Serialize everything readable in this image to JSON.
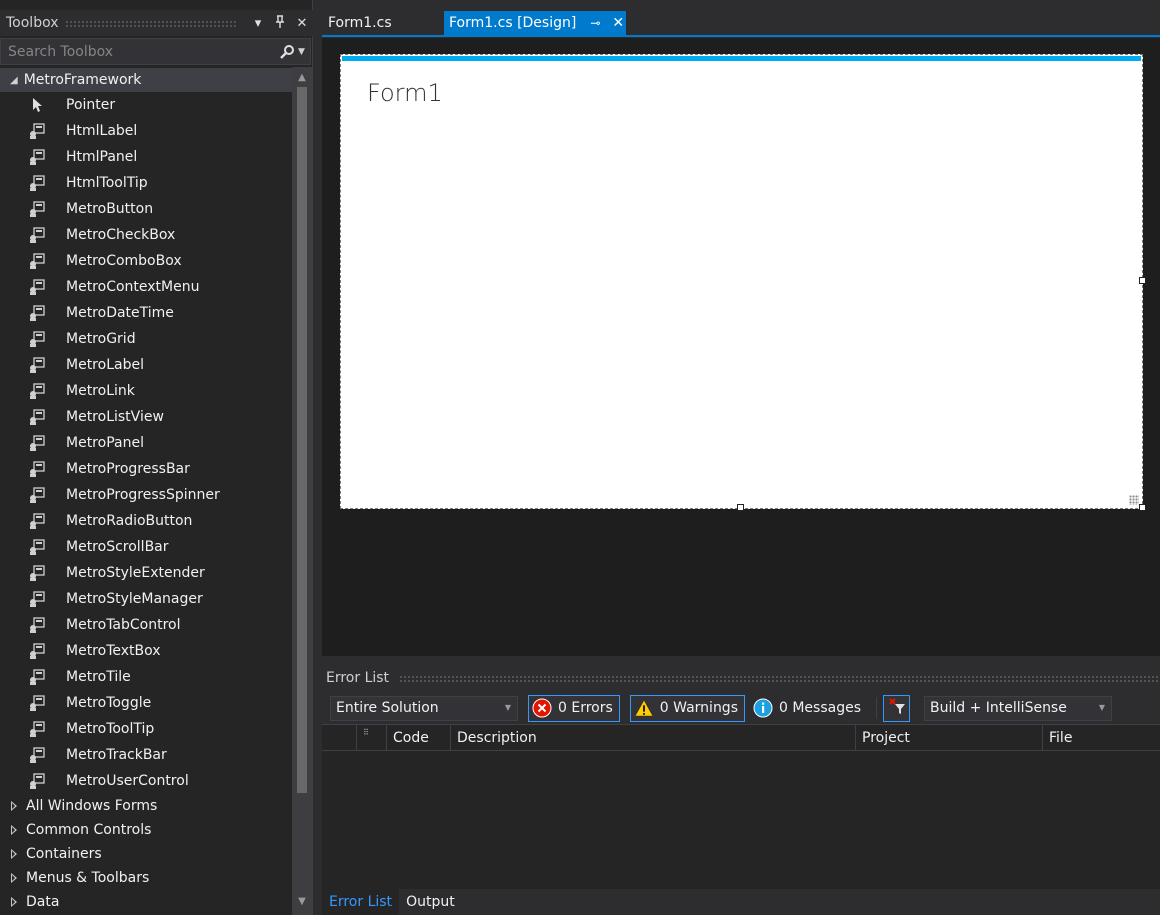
{
  "toolbox": {
    "title": "Toolbox",
    "search_placeholder": "Search Toolbox",
    "open_category": "MetroFramework",
    "items": [
      {
        "label": "Pointer",
        "icon": "pointer-icon"
      },
      {
        "label": "HtmlLabel",
        "icon": "component-icon"
      },
      {
        "label": "HtmlPanel",
        "icon": "component-icon"
      },
      {
        "label": "HtmlToolTip",
        "icon": "component-icon"
      },
      {
        "label": "MetroButton",
        "icon": "component-icon"
      },
      {
        "label": "MetroCheckBox",
        "icon": "component-icon"
      },
      {
        "label": "MetroComboBox",
        "icon": "component-icon"
      },
      {
        "label": "MetroContextMenu",
        "icon": "component-icon"
      },
      {
        "label": "MetroDateTime",
        "icon": "component-icon"
      },
      {
        "label": "MetroGrid",
        "icon": "component-icon"
      },
      {
        "label": "MetroLabel",
        "icon": "component-icon"
      },
      {
        "label": "MetroLink",
        "icon": "component-icon"
      },
      {
        "label": "MetroListView",
        "icon": "component-icon"
      },
      {
        "label": "MetroPanel",
        "icon": "component-icon"
      },
      {
        "label": "MetroProgressBar",
        "icon": "component-icon"
      },
      {
        "label": "MetroProgressSpinner",
        "icon": "component-icon"
      },
      {
        "label": "MetroRadioButton",
        "icon": "component-icon"
      },
      {
        "label": "MetroScrollBar",
        "icon": "component-icon"
      },
      {
        "label": "MetroStyleExtender",
        "icon": "component-icon"
      },
      {
        "label": "MetroStyleManager",
        "icon": "component-icon"
      },
      {
        "label": "MetroTabControl",
        "icon": "component-icon"
      },
      {
        "label": "MetroTextBox",
        "icon": "component-icon"
      },
      {
        "label": "MetroTile",
        "icon": "component-icon"
      },
      {
        "label": "MetroToggle",
        "icon": "component-icon"
      },
      {
        "label": "MetroToolTip",
        "icon": "component-icon"
      },
      {
        "label": "MetroTrackBar",
        "icon": "component-icon"
      },
      {
        "label": "MetroUserControl",
        "icon": "component-icon"
      }
    ],
    "collapsed_categories": [
      "All Windows Forms",
      "Common Controls",
      "Containers",
      "Menus & Toolbars",
      "Data"
    ]
  },
  "editor": {
    "tabs": [
      {
        "label": "Form1.cs",
        "active": false
      },
      {
        "label": "Form1.cs [Design]",
        "active": true
      }
    ],
    "accent": "#007acc"
  },
  "designer": {
    "form_title": "Form1",
    "form_accent": "#00aaee"
  },
  "error_list": {
    "title": "Error List",
    "scope": "Entire Solution",
    "errors_label": "0 Errors",
    "warnings_label": "0 Warnings",
    "messages_label": "0 Messages",
    "source": "Build + IntelliSense",
    "columns": [
      "Code",
      "Description",
      "Project",
      "File"
    ]
  },
  "bottom_tabs": [
    {
      "label": "Error List",
      "active": true
    },
    {
      "label": "Output",
      "active": false
    }
  ]
}
